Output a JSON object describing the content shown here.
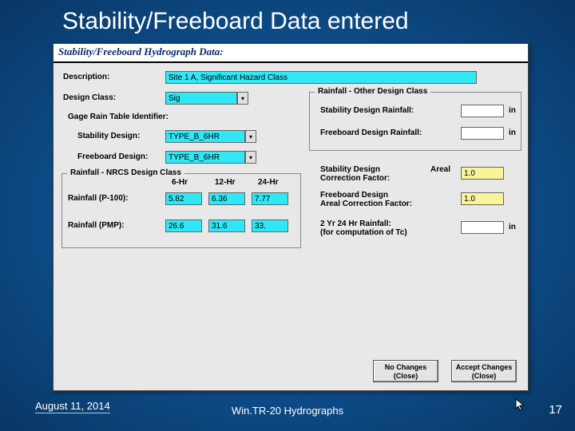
{
  "slide": {
    "title": "Stability/Freeboard Data entered",
    "footer_date": "August 11, 2014",
    "footer_center": "Win.TR-20 Hydrographs",
    "footer_page": "17"
  },
  "window": {
    "header": "Stability/Freeboard Hydrograph Data:"
  },
  "form": {
    "description_label": "Description:",
    "description_value": "Site 1 A, Significant Hazard Class",
    "design_class_label": "Design Class:",
    "design_class_value": "Sig",
    "gage_rain_label": "Gage Rain Table Identifier:",
    "stability_design_label": "Stability Design:",
    "stability_design_value": "TYPE_B_6HR",
    "freeboard_design_label": "Freeboard Design:",
    "freeboard_design_value": "TYPE_B_6HR",
    "nrcs_group_title": "Rainfall - NRCS Design Class",
    "col_6hr": "6-Hr",
    "col_12hr": "12-Hr",
    "col_24hr": "24-Hr",
    "rainfall_p100_label": "Rainfall (P-100):",
    "rainfall_p100_6": "5.82",
    "rainfall_p100_12": "6.36",
    "rainfall_p100_24": "7.77",
    "rainfall_pmp_label": "Rainfall (PMP):",
    "rainfall_pmp_6": "26.6",
    "rainfall_pmp_12": "31.6",
    "rainfall_pmp_24": "33.",
    "other_group_title": "Rainfall - Other Design Class",
    "stability_rainfall_label": "Stability Design Rainfall:",
    "freeboard_rainfall_label": "Freeboard Design Rainfall:",
    "stability_corr_label": "Stability Design\nCorrection Factor:",
    "stability_corr_areal": "Areal",
    "stability_corr_value": "1.0",
    "freeboard_corr_label": "Freeboard Design\nAreal Correction Factor:",
    "freeboard_corr_value": "1.0",
    "zyr_label": "2 Yr 24 Hr Rainfall:\n(for computation of Tc)",
    "unit_in": "in",
    "btn_no_changes": "No Changes\n(Close)",
    "btn_accept": "Accept Changes\n(Close)"
  }
}
